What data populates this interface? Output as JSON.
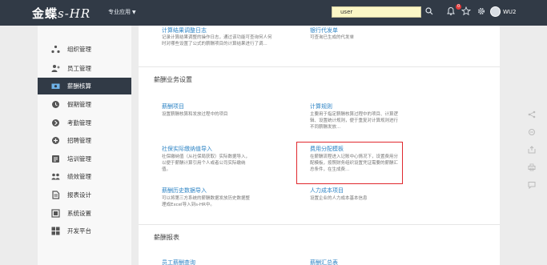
{
  "header": {
    "logo_cn": "金蝶",
    "logo_en": "s-HR",
    "nav_label": "专业应用",
    "search_value": "user",
    "notification_count": "0",
    "username": "WU2"
  },
  "sidebar": {
    "items": [
      {
        "label": "组织管理",
        "icon": "org-icon"
      },
      {
        "label": "员工管理",
        "icon": "employee-icon"
      },
      {
        "label": "薪酬核算",
        "icon": "salary-icon",
        "active": true
      },
      {
        "label": "假期管理",
        "icon": "leave-icon"
      },
      {
        "label": "考勤管理",
        "icon": "attendance-icon"
      },
      {
        "label": "招聘管理",
        "icon": "recruit-icon"
      },
      {
        "label": "培训管理",
        "icon": "training-icon"
      },
      {
        "label": "绩效管理",
        "icon": "performance-icon"
      },
      {
        "label": "报表设计",
        "icon": "report-icon"
      },
      {
        "label": "系统设置",
        "icon": "settings-icon"
      },
      {
        "label": "开发平台",
        "icon": "dev-icon"
      }
    ]
  },
  "main": {
    "top_cards": [
      {
        "title": "计算结果调整日志",
        "desc": "记录计算结果调整的操作日志，通过该功能可查询何人何时对哪些设置了公式的薪酬项目的计算结果进行了调..."
      },
      {
        "title": "银行代发单",
        "desc": "可查询已生成的代发单"
      }
    ],
    "section_business": {
      "title": "薪酬业务设置",
      "cards": [
        {
          "title": "薪酬项目",
          "desc": "设置薪酬核算和发放过程中的项目"
        },
        {
          "title": "计算规则",
          "desc": "主要用于指定薪酬核算过程中的项目、计算逻辑、设置统计规则，便于重复对计算规则进行不同薪酬发放..."
        },
        {
          "title": "社保实际缴纳值导入",
          "desc": "社保缴纳值（从社保局获取）实际数据导入，以便于薪酬计算引用个人或者公司实际缴纳值。"
        },
        {
          "title": "费用分配模板",
          "desc": "在薪酬流程进入记账中心情况下，设置费用分配模板，按照财务组织设置凭证需要的薪酬汇总条件，在生成费..."
        },
        {
          "title": "薪酬历史数据导入",
          "desc": "可以将第三方系统的薪酬数据发放历史数据整理成Excel导入到s-HR中。"
        },
        {
          "title": "人力成本项目",
          "desc": "设置企业的人力成本基本信息"
        }
      ]
    },
    "section_report": {
      "title": "薪酬报表",
      "cards": [
        {
          "title": "员工薪酬查询"
        },
        {
          "title": "薪酬汇总表"
        }
      ]
    }
  },
  "colors": {
    "topbar": "#313a46",
    "link": "#2e84c5",
    "highlight": "#e0282e",
    "active_sidebar": "#313a46"
  }
}
